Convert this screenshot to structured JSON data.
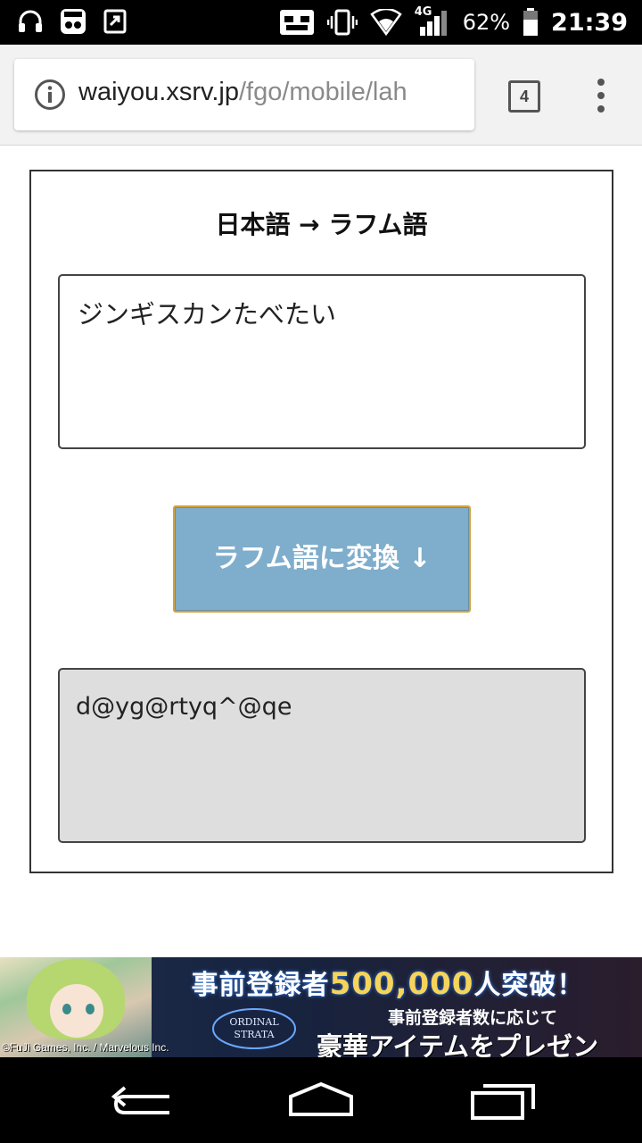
{
  "status_bar": {
    "left_icons": [
      "headset-icon",
      "quest-app-icon",
      "share-app-icon"
    ],
    "right_icons": [
      "cast-icon",
      "vibrate-icon",
      "wifi-icon",
      "signal-4g-icon",
      "battery-icon"
    ],
    "network": "4G",
    "battery": "62%",
    "time": "21:39"
  },
  "browser": {
    "url_host": "waiyou.xsrv.jp",
    "url_path": "/fgo/mobile/lah",
    "tab_count": "4",
    "info_icon": "info-icon",
    "menu_icon": "more-vert-icon"
  },
  "translator": {
    "title": "日本語 → ラフム語",
    "input_value": "ジンギスカンたべたい",
    "convert_label": "ラフム語に変換 ↓",
    "output_value": "d@yg@rtyq^@qe"
  },
  "ad": {
    "headline_pre": "事前登録者",
    "headline_num": "500,000",
    "headline_post": "人突破！",
    "logo_text": "ORDINAL STRATA",
    "sub1": "事前登録者数に応じて",
    "sub2": "豪華アイテムをプレゼント！",
    "copyright": "©FuJi Games, Inc. / Marvelous Inc."
  },
  "nav": {
    "back_icon": "back-icon",
    "home_icon": "home-icon",
    "recents_icon": "recents-icon"
  },
  "colors": {
    "button_bg": "#7fadcc",
    "button_border": "#d4a23a",
    "output_bg": "#dedede"
  }
}
